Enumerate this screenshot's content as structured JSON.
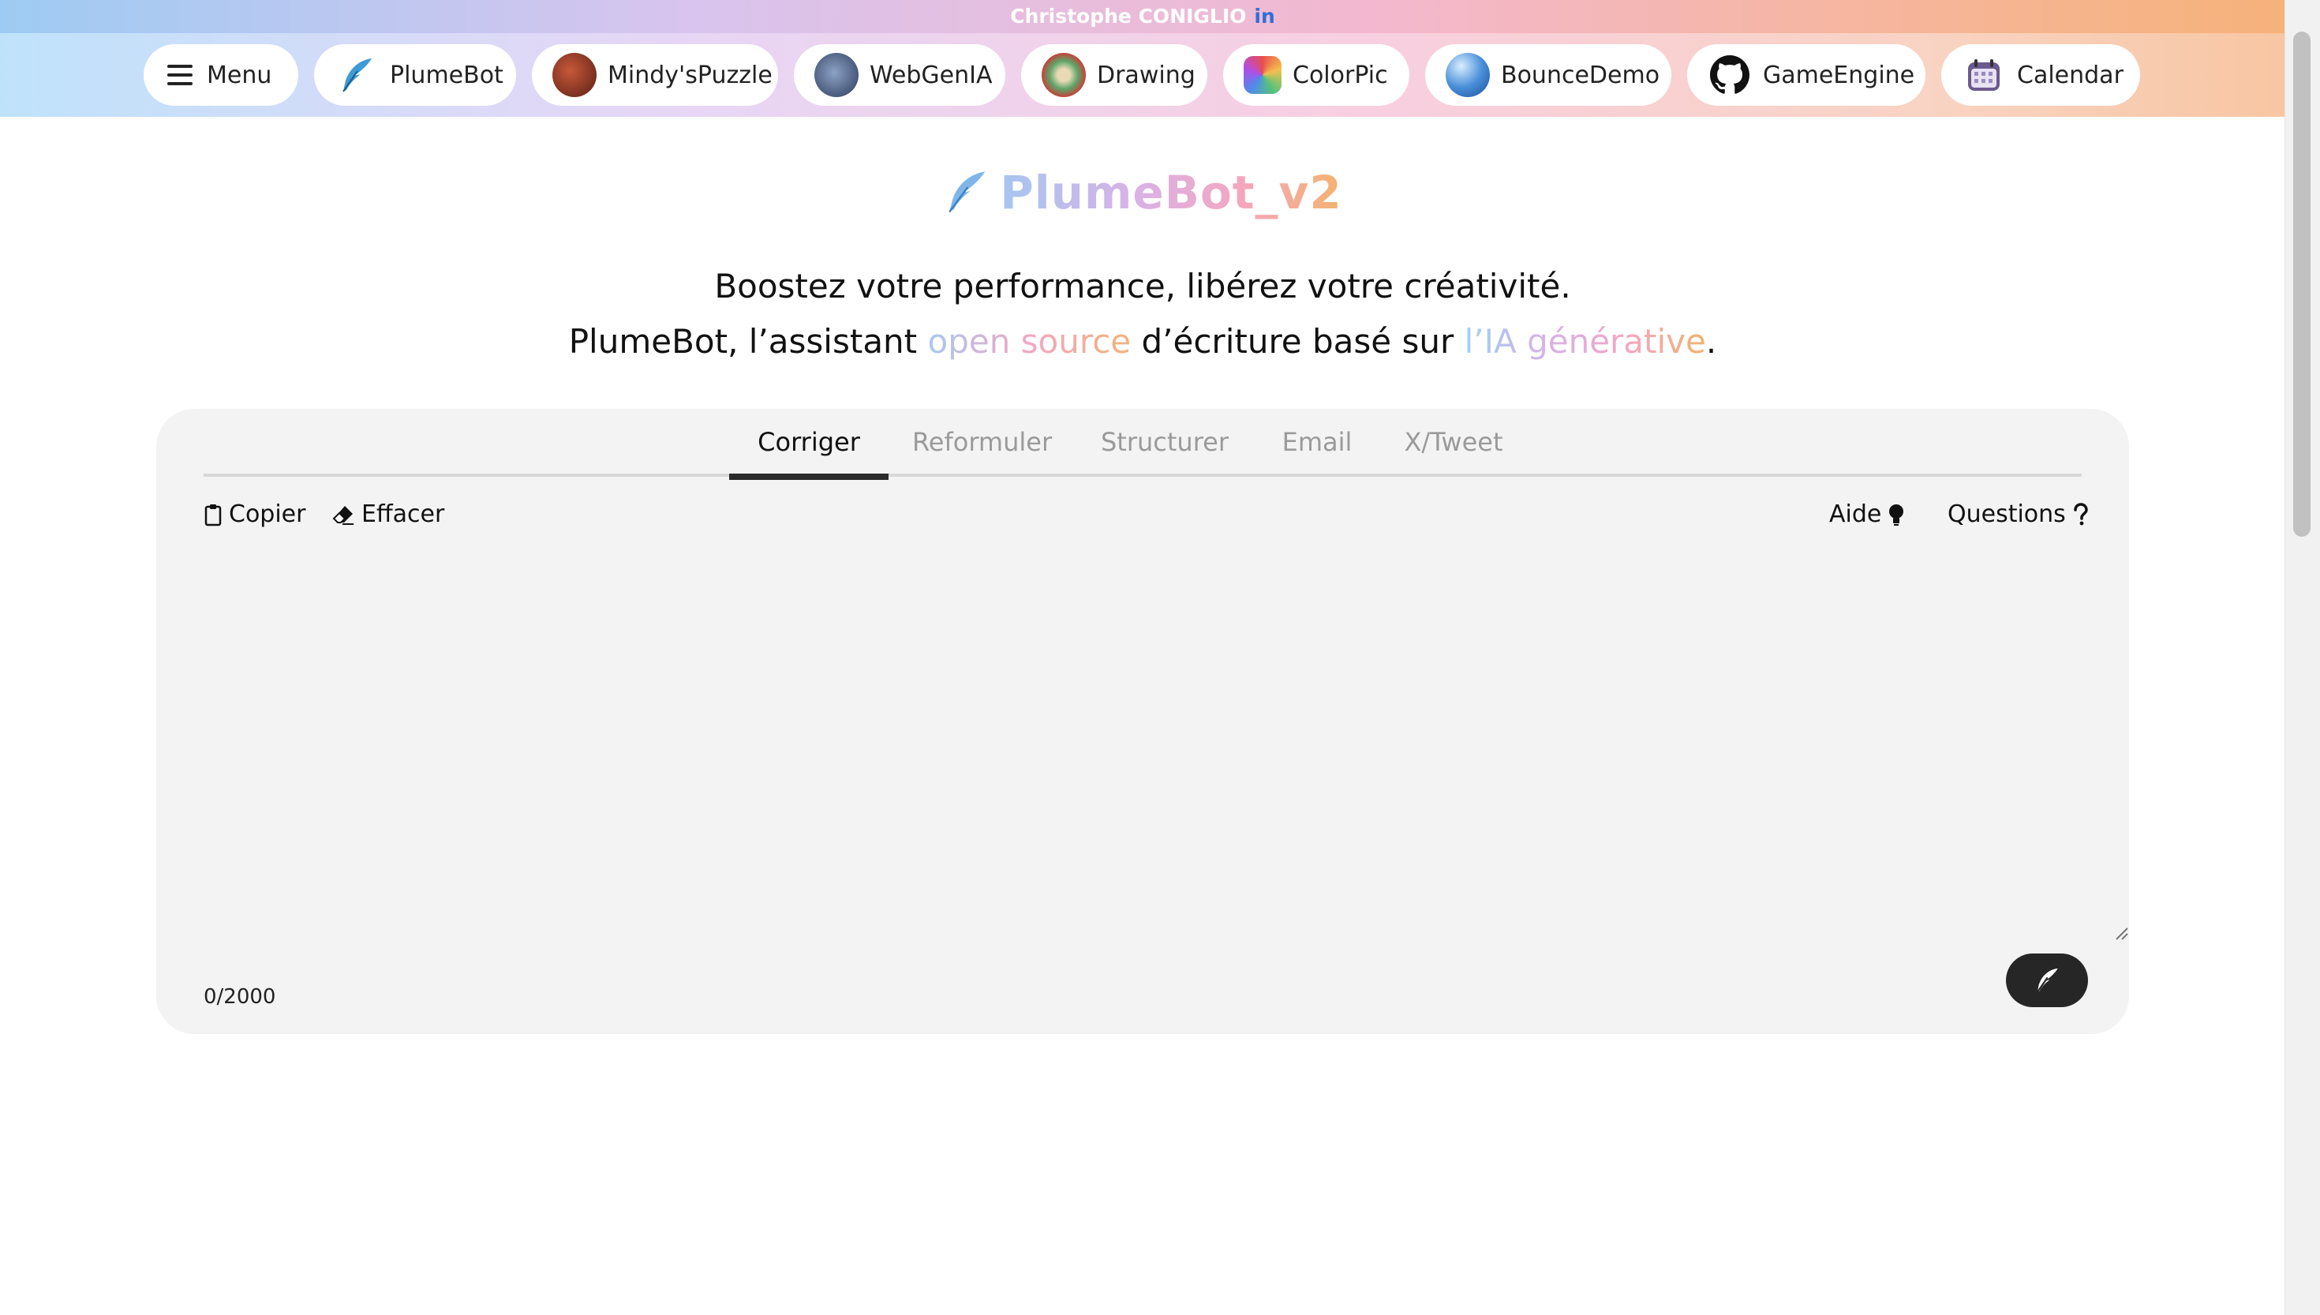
{
  "banner": {
    "author": "Christophe CONIGLIO",
    "linkedin": "in"
  },
  "nav": {
    "menu_label": "Menu",
    "items": [
      {
        "label": "PlumeBot",
        "icon": "feather-icon"
      },
      {
        "label": "Mindy'sPuzzle",
        "icon": "puzzle-icon"
      },
      {
        "label": "WebGenIA",
        "icon": "webgen-icon"
      },
      {
        "label": "Drawing",
        "icon": "drawing-icon"
      },
      {
        "label": "ColorPic",
        "icon": "colorpic-icon"
      },
      {
        "label": "BounceDemo",
        "icon": "ball-icon"
      },
      {
        "label": "GameEngine",
        "icon": "github-icon"
      },
      {
        "label": "Calendar",
        "icon": "calendar-icon"
      }
    ]
  },
  "header": {
    "title": "PlumeBot_v2",
    "tagline1": "Boostez votre performance, libérez votre créativité.",
    "tagline2_a": "PlumeBot, l’assistant ",
    "tagline2_b": "open source",
    "tagline2_c": " d’écriture basé sur ",
    "tagline2_d": "l’IA générative",
    "tagline2_e": "."
  },
  "tabs": [
    "Corriger",
    "Reformuler",
    "Structurer",
    "Email",
    "X/Tweet"
  ],
  "active_tab": "Corriger",
  "toolbar": {
    "copy": "Copier",
    "clear": "Effacer",
    "help": "Aide",
    "questions": "Questions"
  },
  "editor": {
    "value": "",
    "placeholder": "",
    "counter": "0/2000"
  },
  "colors": {
    "accent": "#262626",
    "card_bg": "#f3f3f3",
    "tab_inactive": "#9a9a9a"
  }
}
